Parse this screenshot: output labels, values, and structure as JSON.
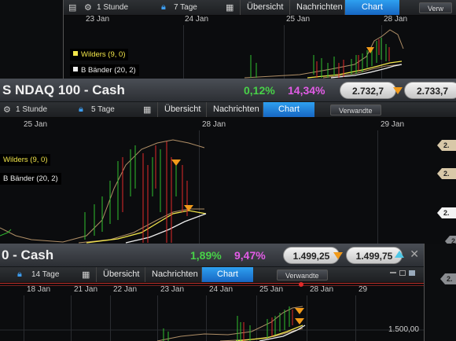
{
  "panel_top": {
    "toolbar": {
      "interval": "1 Stunde",
      "range": "7 Tage",
      "tabs": [
        "Übersicht",
        "Nachrichten",
        "Chart"
      ],
      "related_truncated": "Verw"
    },
    "dates": [
      "23 Jan",
      "24 Jan",
      "25 Jan",
      "28 Jan"
    ],
    "legend": {
      "indicator1": "Wilders (9, 0)",
      "indicator2": "B Bänder (20, 2)"
    }
  },
  "panel_mid": {
    "title": "S NDAQ 100 - Cash",
    "change_pct": "0,12%",
    "change_pct2": "14,34%",
    "bid": "2.732,7",
    "ask": "2.733,7",
    "toolbar": {
      "interval": "1 Stunde",
      "range": "5 Tage",
      "tabs": [
        "Übersicht",
        "Nachrichten",
        "Chart"
      ],
      "related": "Verwandte"
    },
    "dates": [
      "25 Jan",
      "28 Jan",
      "29 Jan"
    ],
    "legend": {
      "indicator1": "Wilders (9, 0)",
      "indicator2": "B Bänder (20, 2)"
    },
    "price_tags": [
      "2.",
      "2.",
      "2.",
      "2."
    ]
  },
  "panel_bottom": {
    "title": "0 - Cash",
    "change_pct": "1,89%",
    "change_pct2": "9,47%",
    "bid": "1.499,25",
    "ask": "1.499,75",
    "toolbar": {
      "range": "14 Tage",
      "tabs": [
        "Übersicht",
        "Nachrichten",
        "Chart"
      ],
      "related": "Verwandte"
    },
    "dates": [
      "18 Jan",
      "21 Jan",
      "22 Jan",
      "23 Jan",
      "24 Jan",
      "25 Jan",
      "28 Jan",
      "29"
    ],
    "y_label": "1.500,00",
    "price_tags": [
      "2."
    ]
  },
  "colors": {
    "up": "#2fbf2f",
    "down": "#e02a2a",
    "active_tab": "#1f86dd",
    "indicator": "#f2e64a",
    "band": "#b08f67"
  }
}
